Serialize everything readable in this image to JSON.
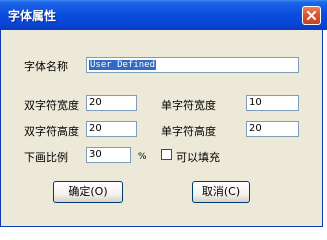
{
  "dialog": {
    "title": "字体属性",
    "close_icon": "close-icon"
  },
  "fields": {
    "font_name_label": "字体名称",
    "font_name_value": "User Defined",
    "double_width_label": "双字符宽度",
    "double_width_value": "20",
    "single_width_label": "单字符宽度",
    "single_width_value": "10",
    "double_height_label": "双字符高度",
    "double_height_value": "20",
    "single_height_label": "单字符高度",
    "single_height_value": "20",
    "subscript_label": "下画比例",
    "subscript_value": "30",
    "percent_sign": "%",
    "fill_label": "可以填充",
    "fill_checked": false
  },
  "buttons": {
    "ok_label": "确定(O)",
    "cancel_label": "取消(C)"
  }
}
